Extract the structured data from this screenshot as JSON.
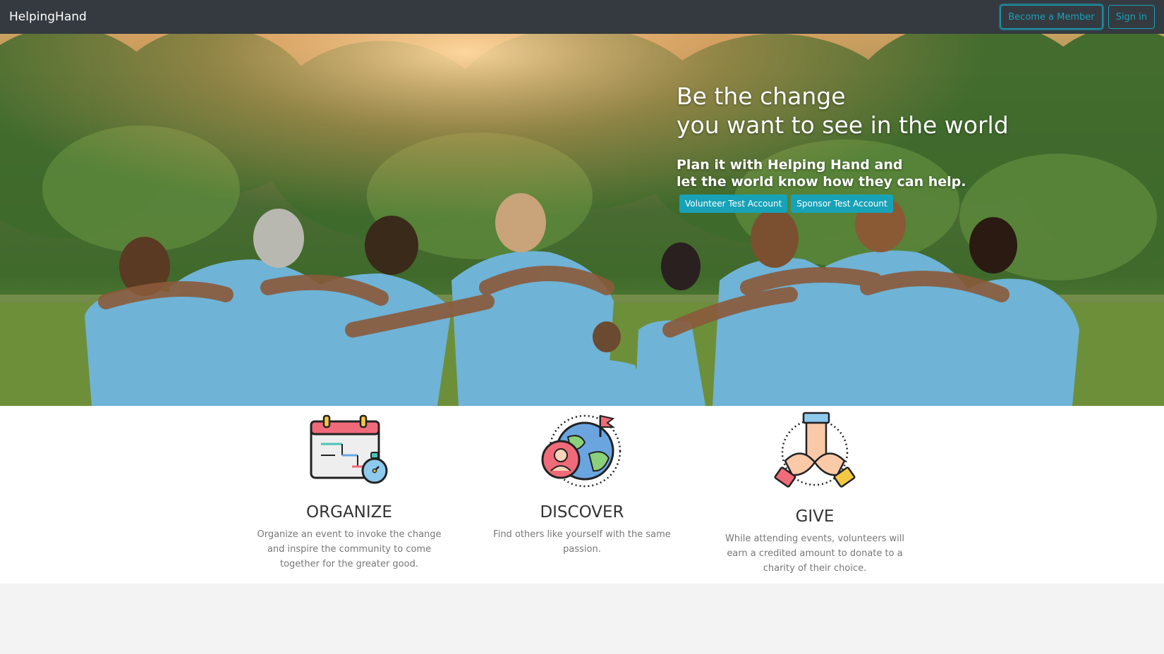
{
  "navbar": {
    "brand": "HelpingHand",
    "become_member_label": "Become a Member",
    "sign_in_label": "Sign in"
  },
  "hero": {
    "headline_line1": "Be the change",
    "headline_line2": "you want to see in the world",
    "subline_line1": "Plan it with Helping Hand and",
    "subline_line2": "let the world know how they can help.",
    "volunteer_button": "Volunteer Test Account",
    "sponsor_button": "Sponsor Test Account"
  },
  "features": [
    {
      "icon": "calendar-stopwatch-icon",
      "title": "ORGANIZE",
      "description": "Organize an event to invoke the change and inspire the community to come together for the greater good."
    },
    {
      "icon": "globe-person-flag-icon",
      "title": "DISCOVER",
      "description": "Find others like yourself with the same passion."
    },
    {
      "icon": "stacked-hands-icon",
      "title": "GIVE",
      "description": "While attending events, volunteers will earn a credited amount to donate to a charity of their choice."
    }
  ],
  "colors": {
    "navbar": "#343a40",
    "accent": "#17a2b8",
    "shirt": "#6fb3d6"
  }
}
